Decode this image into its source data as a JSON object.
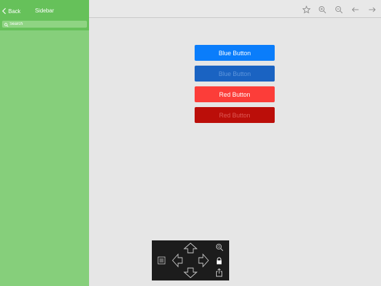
{
  "sidebar": {
    "back_label": "Back",
    "title": "Sidebar",
    "search_placeholder": "Search"
  },
  "toolbar": {
    "icons": [
      "star-icon",
      "zoom-in-icon",
      "zoom-out-icon",
      "arrow-left-icon",
      "arrow-right-icon"
    ]
  },
  "buttons": {
    "blue": "Blue Button",
    "blue_disabled": "Blue Button",
    "red": "Red Button",
    "red_disabled": "Red Button"
  },
  "colors": {
    "sidebar_bg": "#86cf7b",
    "sidebar_header": "#66c15a",
    "blue": "#0a7dfb",
    "blue_disabled": "#1a63c2",
    "red": "#fc3d39",
    "red_disabled": "#bb0e09",
    "pad_bg": "#1c1c1c"
  },
  "control_pad": {
    "icons": [
      "menu-icon",
      "arrow-up-icon",
      "arrow-left-icon",
      "arrow-right-icon",
      "arrow-down-icon",
      "zoom-icon",
      "lock-icon",
      "share-icon"
    ]
  }
}
